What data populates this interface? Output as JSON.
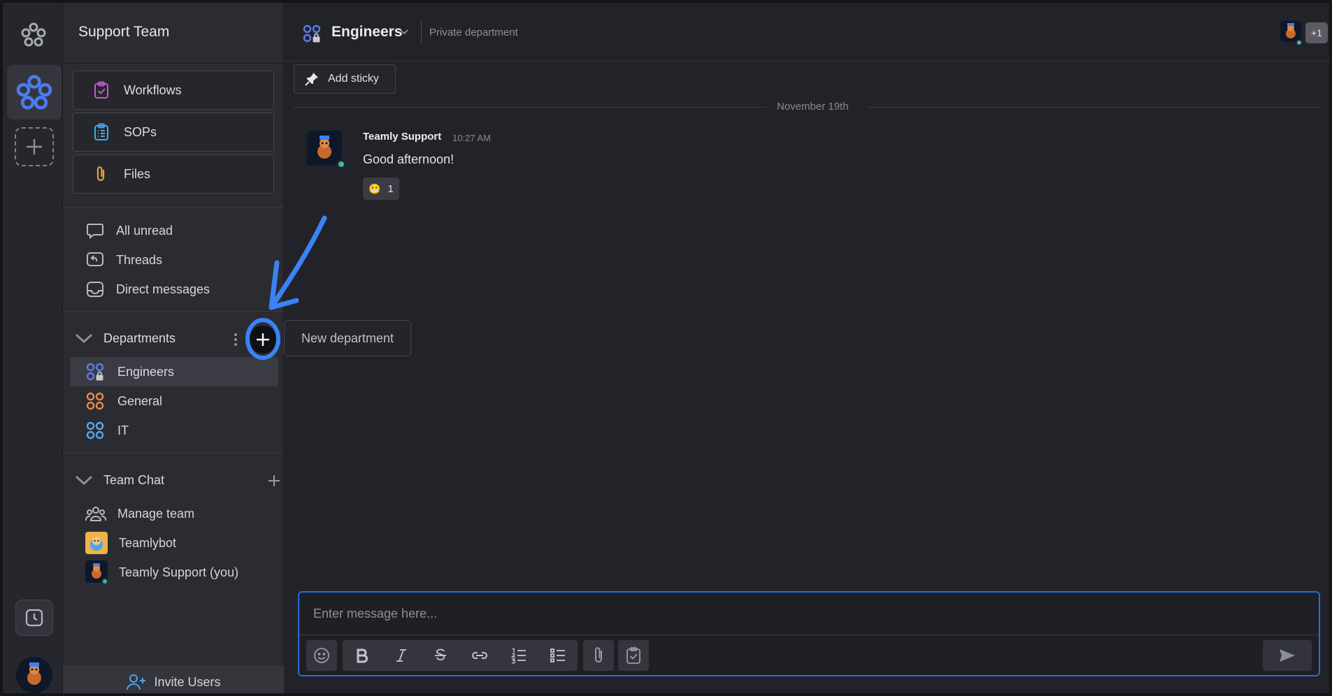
{
  "sidebar": {
    "team_title": "Support Team",
    "big_buttons": [
      {
        "label": "Workflows",
        "icon": "clipboard-check-icon"
      },
      {
        "label": "SOPs",
        "icon": "list-clipboard-icon"
      },
      {
        "label": "Files",
        "icon": "paperclip-icon"
      }
    ],
    "nav": [
      {
        "label": "All unread",
        "icon": "chat-bubble-icon"
      },
      {
        "label": "Threads",
        "icon": "reply-bubble-icon"
      },
      {
        "label": "Direct messages",
        "icon": "inbox-icon"
      }
    ],
    "departments": {
      "title": "Departments",
      "items": [
        {
          "label": "Engineers",
          "color": "#5b7de8",
          "locked": true
        },
        {
          "label": "General",
          "color": "#e98a4d",
          "locked": false
        },
        {
          "label": "IT",
          "color": "#5aa7ec",
          "locked": false
        }
      ]
    },
    "team_chat": {
      "title": "Team Chat",
      "items": [
        {
          "label": "Manage team",
          "icon": "group-icon"
        },
        {
          "label": "Teamlybot",
          "icon": "bot-avatar"
        },
        {
          "label": "Teamly Support (you)",
          "icon": "user-avatar"
        }
      ]
    },
    "invite_label": "Invite Users"
  },
  "tooltip": "New department",
  "channel": {
    "name": "Engineers",
    "description": "Private department",
    "member_extra": "+1"
  },
  "toolbar": {
    "sticky_label": "Add sticky"
  },
  "timeline": {
    "date_label": "November 19th",
    "messages": [
      {
        "author": "Teamly Support",
        "time": "10:27 AM",
        "text": "Good afternoon!",
        "reaction_count": "1",
        "reaction_emoji": "😬"
      }
    ]
  },
  "composer": {
    "placeholder": "Enter message here...",
    "tools": [
      "emoji-icon",
      "bold-icon",
      "italic-icon",
      "strikethrough-icon",
      "link-icon",
      "ordered-list-icon",
      "bullet-list-icon",
      "attach-icon",
      "task-icon"
    ]
  },
  "colors": {
    "accent": "#2d6bd6",
    "annotation": "#3b82f6",
    "online": "#3fb9a6"
  }
}
